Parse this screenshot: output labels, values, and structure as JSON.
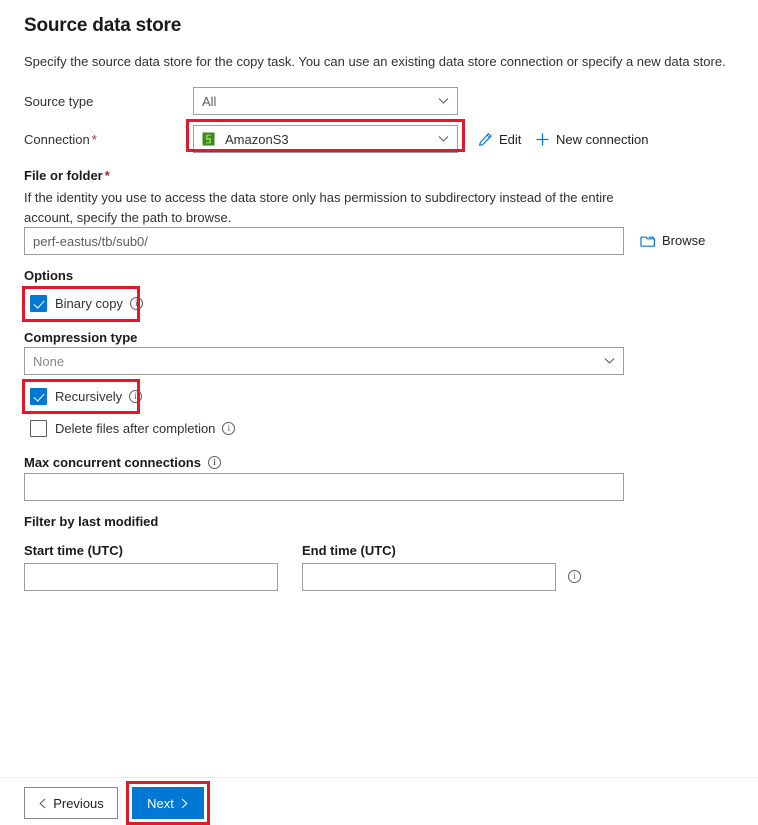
{
  "header": {
    "title": "Source data store",
    "description": "Specify the source data store for the copy task. You can use an existing data store connection or specify a new data store."
  },
  "form": {
    "source_type": {
      "label": "Source type",
      "value": "All"
    },
    "connection": {
      "label": "Connection",
      "required_marker": "*",
      "value": "AmazonS3",
      "icon": "amazon-s3-icon",
      "edit_label": "Edit",
      "new_connection_label": "New connection"
    },
    "file_or_folder": {
      "label": "File or folder",
      "required_marker": "*",
      "help_line1": "If the identity you use to access the data store only has permission to subdirectory instead of the entire",
      "help_line2": "account, specify the path to browse.",
      "value": "perf-eastus/tb/sub0/",
      "browse_label": "Browse"
    },
    "options": {
      "label": "Options",
      "binary_copy": {
        "label": "Binary copy",
        "checked": true,
        "info": "i"
      },
      "compression_type": {
        "label": "Compression type",
        "value": "None"
      },
      "recursively": {
        "label": "Recursively",
        "checked": true,
        "info": "i"
      },
      "delete_files": {
        "label": "Delete files after completion",
        "checked": false,
        "info": "i"
      }
    },
    "max_concurrent_connections": {
      "label": "Max concurrent connections",
      "value": "",
      "info": "i"
    },
    "filter_by_last_modified": {
      "label": "Filter by last modified",
      "start_time": {
        "label": "Start time (UTC)",
        "value": ""
      },
      "end_time": {
        "label": "End time (UTC)",
        "value": "",
        "info": "i"
      }
    }
  },
  "footer": {
    "previous_label": "Previous",
    "next_label": "Next"
  },
  "colors": {
    "accent": "#0078d4",
    "highlight": "#e2192c",
    "required": "#a4262c",
    "s3_green": "#3f8624"
  }
}
